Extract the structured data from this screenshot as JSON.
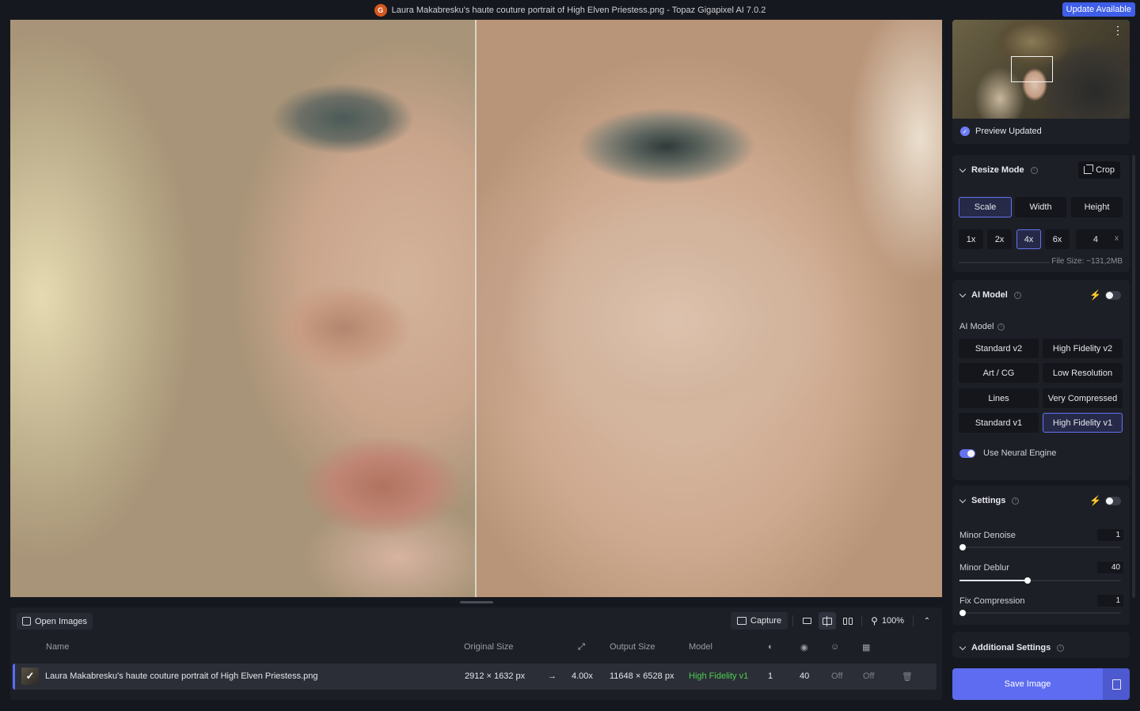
{
  "titlebar": {
    "title": "Laura Makabresku's haute couture portrait of High Elven Priestess.png - Topaz Gigapixel AI 7.0.2",
    "logo_letter": "G",
    "update_label": "Update Available"
  },
  "bottom": {
    "open_images_label": "Open Images",
    "capture_label": "Capture",
    "zoom": "100%",
    "columns": {
      "name": "Name",
      "original_size": "Original Size",
      "output_size": "Output Size",
      "model": "Model"
    },
    "row": {
      "name": "Laura Makabresku's haute couture portrait of High Elven Priestess.png",
      "original_size": "2912 × 1632 px",
      "scale": "4.00x",
      "output_size": "11648 × 6528 px",
      "model": "High Fidelity v1",
      "denoise": "1",
      "deblur": "40",
      "face": "Off",
      "other": "Off"
    }
  },
  "sidebar": {
    "preview_status": "Preview Updated",
    "resize": {
      "title": "Resize Mode",
      "crop_label": "Crop",
      "modes": [
        "Scale",
        "Width",
        "Height"
      ],
      "selected_mode": "Scale",
      "scales": [
        "1x",
        "2x",
        "4x",
        "6x"
      ],
      "selected_scale": "4x",
      "custom_value": "4",
      "custom_unit": "x",
      "file_size": "File Size: ~131,2MB"
    },
    "ai_model": {
      "title": "AI Model",
      "sub_label": "AI Model",
      "models": [
        "Standard v2",
        "High Fidelity v2",
        "Art / CG",
        "Low Resolution",
        "Lines",
        "Very Compressed",
        "Standard v1",
        "High Fidelity v1"
      ],
      "selected_model": "High Fidelity v1",
      "neural_engine_label": "Use Neural Engine",
      "neural_engine_on": true
    },
    "settings": {
      "title": "Settings",
      "sliders": [
        {
          "label": "Minor Denoise",
          "value": "1",
          "level": 0.0
        },
        {
          "label": "Minor Deblur",
          "value": "40",
          "level": 0.4
        },
        {
          "label": "Fix Compression",
          "value": "1",
          "level": 0.0
        }
      ]
    },
    "additional": {
      "title": "Additional Settings"
    },
    "save_label": "Save Image"
  },
  "colors": {
    "accent": "#5d6cf0",
    "background": "#16181f",
    "panel": "#1d1f27",
    "model_green": "#4fce4f",
    "update_blue": "#3f5ee8"
  }
}
